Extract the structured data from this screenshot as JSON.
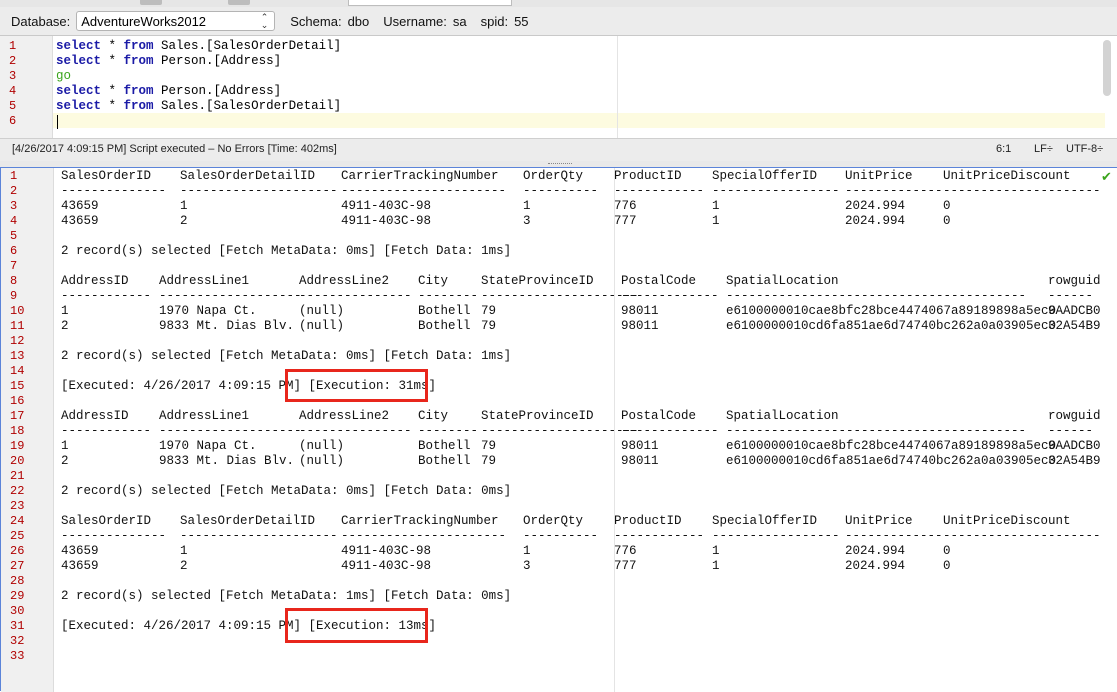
{
  "connection": {
    "database_label": "Database:",
    "database_value": "AdventureWorks2012",
    "schema_label": "Schema:",
    "schema_value": "dbo",
    "username_label": "Username:",
    "username_value": "sa",
    "spid_label": "spid:",
    "spid_value": "55"
  },
  "editor": {
    "line_numbers": [
      "1",
      "2",
      "3",
      "4",
      "5",
      "6"
    ],
    "lines": [
      {
        "kw1": "select",
        "mid": " * ",
        "kw2": "from",
        "rest": " Sales.[SalesOrderDetail]"
      },
      {
        "kw1": "select",
        "mid": " * ",
        "kw2": "from",
        "rest": " Person.[Address]"
      },
      {
        "go": "go"
      },
      {
        "kw1": "select",
        "mid": " * ",
        "kw2": "from",
        "rest": " Person.[Address]"
      },
      {
        "kw1": "select",
        "mid": " * ",
        "kw2": "from",
        "rest": " Sales.[SalesOrderDetail]"
      },
      {}
    ]
  },
  "status": {
    "message": "[4/26/2017 4:09:15 PM] Script executed – No Errors [Time: 402ms]",
    "position": "6:1",
    "line_ending": "LF÷",
    "encoding": "UTF-8÷"
  },
  "output": {
    "line_numbers": [
      "1",
      "2",
      "3",
      "4",
      "5",
      "6",
      "7",
      "8",
      "9",
      "10",
      "11",
      "12",
      "13",
      "14",
      "15",
      "16",
      "17",
      "18",
      "19",
      "20",
      "21",
      "22",
      "23",
      "24",
      "25",
      "26",
      "27",
      "28",
      "29",
      "30",
      "31",
      "32",
      "33"
    ],
    "sales_headers": [
      "SalesOrderID",
      "SalesOrderDetailID",
      "CarrierTrackingNumber",
      "OrderQty",
      "ProductID",
      "SpecialOfferID",
      "UnitPrice",
      "UnitPriceDiscount"
    ],
    "sales_separators": [
      "--------------",
      "---------------------",
      "----------------------",
      "----------",
      "------------",
      "-----------------",
      "-------------",
      "---------------------"
    ],
    "sales_rows": [
      [
        "43659",
        "1",
        "4911-403C-98",
        "1",
        "776",
        "1",
        "2024.994",
        "0"
      ],
      [
        "43659",
        "2",
        "4911-403C-98",
        "3",
        "777",
        "1",
        "2024.994",
        "0"
      ]
    ],
    "address_headers": [
      "AddressID",
      "AddressLine1",
      "AddressLine2",
      "City",
      "StateProvinceID",
      "PostalCode",
      "SpatialLocation",
      "rowguid"
    ],
    "address_separators": [
      "------------",
      "-------------------",
      "---------------",
      "--------",
      "---------------------",
      "-------------",
      "----------------------------------------",
      "------"
    ],
    "address_rows": [
      [
        "1",
        "1970 Napa Ct.",
        "(null)",
        "Bothell",
        "79",
        "98011",
        "e6100000010cae8bfc28bce4474067a89189898a5ec0",
        "9AADCB0"
      ],
      [
        "2",
        "9833 Mt. Dias Blv.",
        "(null)",
        "Bothell",
        "79",
        "98011",
        "e6100000010cd6fa851ae6d74740bc262a0a03905ec0",
        "32A54B9"
      ]
    ],
    "summary_1": "2 record(s) selected [Fetch MetaData: 0ms] [Fetch Data: 1ms]",
    "summary_2": "2 record(s) selected [Fetch MetaData: 0ms] [Fetch Data: 1ms]",
    "executed_1": "[Executed: 4/26/2017 4:09:15 PM] [Execution: 31ms]",
    "summary_3": "2 record(s) selected [Fetch MetaData: 0ms] [Fetch Data: 0ms]",
    "summary_4": "2 record(s) selected [Fetch MetaData: 1ms] [Fetch Data: 0ms]",
    "executed_2": "[Executed: 4/26/2017 4:09:15 PM] [Execution: 13ms]"
  },
  "icons": {
    "check": "check-icon",
    "chevron": "up-down-chevron-icon"
  },
  "colors": {
    "highlight": "#e8261c",
    "keyword": "#1a1aa6",
    "go_keyword": "#3aa41c",
    "line_number": "#b00000"
  }
}
